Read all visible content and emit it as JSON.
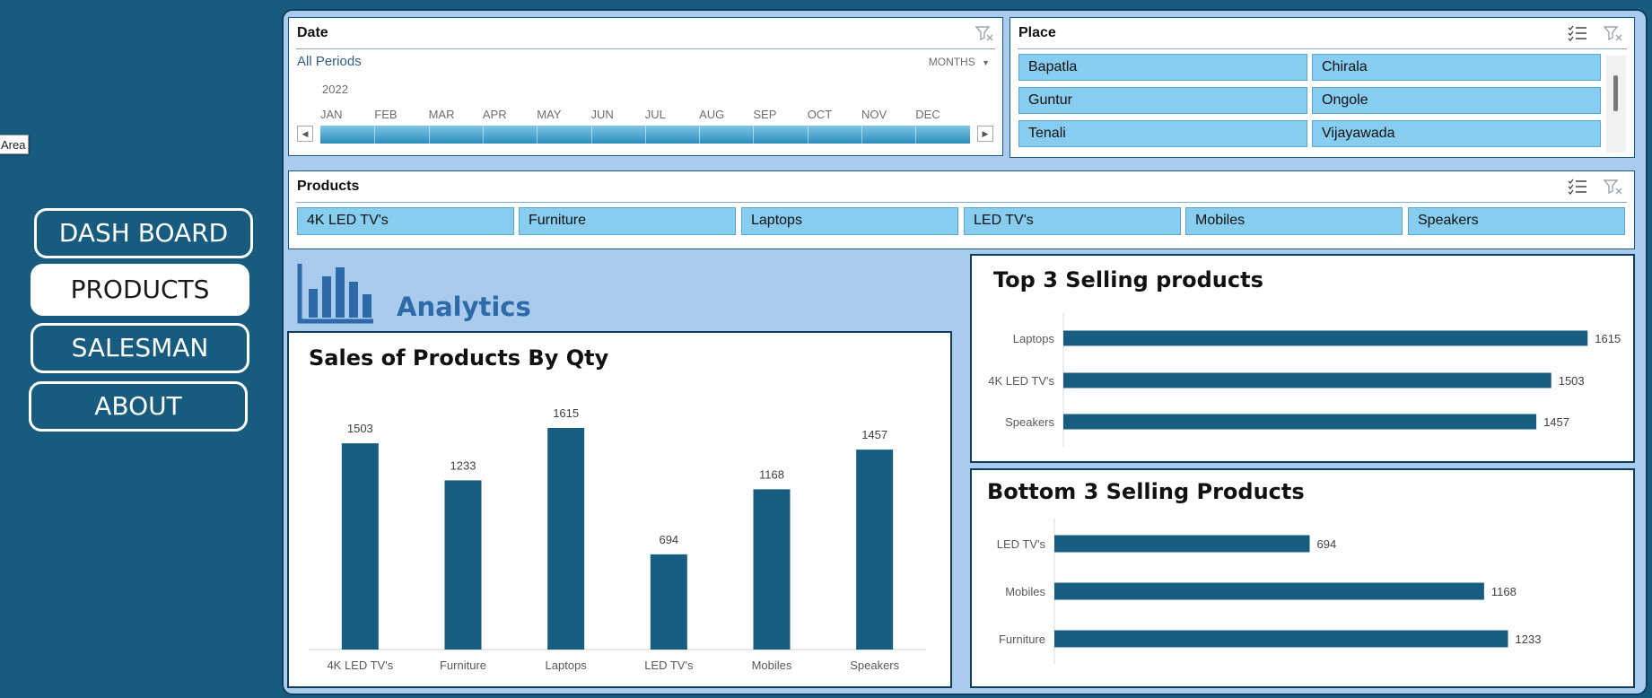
{
  "area_tag": "Area",
  "nav": [
    {
      "label": "DASH BOARD",
      "active": false
    },
    {
      "label": "PRODUCTS",
      "active": true
    },
    {
      "label": "SALESMAN",
      "active": false
    },
    {
      "label": "ABOUT",
      "active": false
    }
  ],
  "date_slicer": {
    "title": "Date",
    "period_label": "All Periods",
    "level_label": "MONTHS",
    "year": "2022",
    "months": [
      "JAN",
      "FEB",
      "MAR",
      "APR",
      "MAY",
      "JUN",
      "JUL",
      "AUG",
      "SEP",
      "OCT",
      "NOV",
      "DEC"
    ]
  },
  "place_slicer": {
    "title": "Place",
    "items": [
      "Bapatla",
      "Chirala",
      "Guntur",
      "Ongole",
      "Tenali",
      "Vijayawada"
    ]
  },
  "products_slicer": {
    "title": "Products",
    "items": [
      "4K LED TV's",
      "Furniture",
      "Laptops",
      "LED TV's",
      "Mobiles",
      "Speakers"
    ]
  },
  "analytics_label": "Analytics",
  "colors": {
    "background": "#175b7e",
    "panel": "#a9cbed",
    "bar": "#175d80",
    "chip": "#86cdef",
    "heading": "#2f6aa8"
  },
  "chart_data": [
    {
      "type": "bar",
      "title": "Sales of Products By Qty",
      "categories": [
        "4K LED TV's",
        "Furniture",
        "Laptops",
        "LED TV's",
        "Mobiles",
        "Speakers"
      ],
      "values": [
        1503,
        1233,
        1615,
        694,
        1168,
        1457
      ],
      "ylim": [
        0,
        1700
      ],
      "grid": false,
      "legend": "none"
    },
    {
      "type": "bar",
      "orientation": "horizontal",
      "title": "Top 3 Selling products",
      "categories": [
        "Laptops",
        "4K LED TV's",
        "Speakers"
      ],
      "values": [
        1615,
        1503,
        1457
      ],
      "xlim": [
        0,
        1700
      ],
      "grid": false,
      "legend": "none"
    },
    {
      "type": "bar",
      "orientation": "horizontal",
      "title": "Bottom 3 Selling Products",
      "categories": [
        "LED TV's",
        "Mobiles",
        "Furniture"
      ],
      "values": [
        694,
        1168,
        1233
      ],
      "xlim": [
        0,
        1300
      ],
      "grid": false,
      "legend": "none"
    }
  ]
}
